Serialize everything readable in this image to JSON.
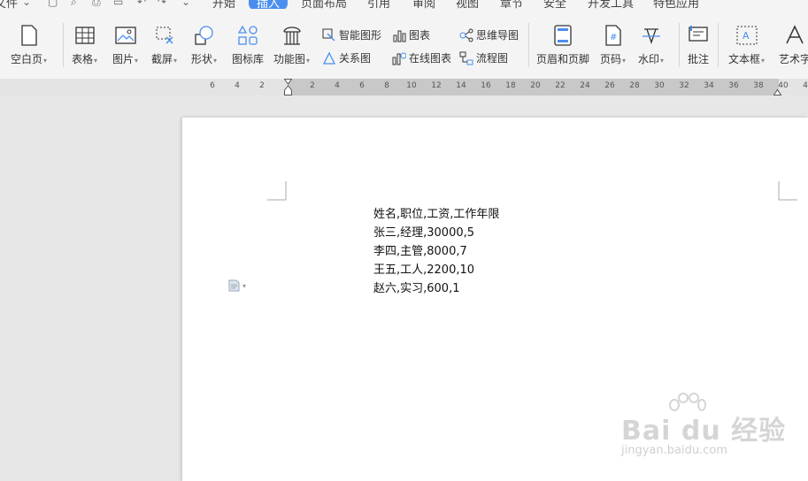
{
  "menubar": {
    "file_fragment": "文件",
    "tabs": [
      "开始",
      "插入",
      "页面布局",
      "引用",
      "审阅",
      "视图",
      "章节",
      "安全",
      "开发工具",
      "特色应用"
    ],
    "active_tab": "插入"
  },
  "ribbon": {
    "blank_page": "空白页",
    "table": "表格",
    "picture": "图片",
    "screenshot": "截屏",
    "shape": "形状",
    "icon_library": "图标库",
    "function_chart": "功能图",
    "smart_shape": "智能图形",
    "relation_chart": "关系图",
    "chart": "图表",
    "online_chart": "在线图表",
    "mind_map": "思维导图",
    "flow_chart": "流程图",
    "header_footer": "页眉和页脚",
    "page_number": "页码",
    "watermark": "水印",
    "comment": "批注",
    "text_box": "文本框",
    "art_text": "艺术字"
  },
  "ruler": {
    "left_numbers": [
      "6",
      "4",
      "2"
    ],
    "right_numbers": [
      "2",
      "4",
      "6",
      "8",
      "10",
      "12",
      "14",
      "16",
      "18",
      "20",
      "22",
      "24",
      "26",
      "28",
      "30",
      "32",
      "34",
      "36",
      "38",
      "40",
      "4"
    ]
  },
  "document": {
    "lines": [
      "姓名,职位,工资,工作年限",
      "张三,经理,30000,5",
      "李四,主管,8000,7",
      "王五,工人,2200,10",
      "赵六,实习,600,1"
    ]
  },
  "watermark": {
    "brand": "Bai du 经验",
    "url": "jingyan.baidu.com"
  },
  "colors": {
    "accent": "#4a8ff0",
    "ribbon_bg": "#f4f4f4",
    "workspace_bg": "#e7e7e7"
  }
}
